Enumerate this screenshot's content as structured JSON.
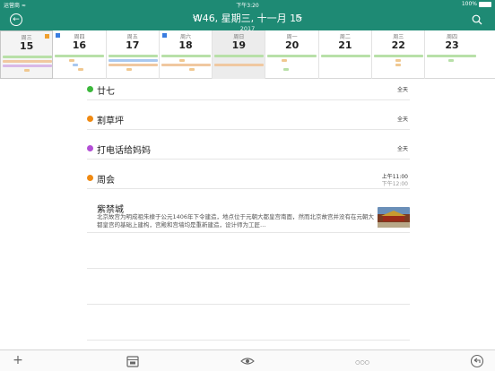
{
  "status_bar": {
    "carrier": "运营商 ≈",
    "time": "下午3:20",
    "battery": "100%"
  },
  "header": {
    "title": "W46, 星期三, 十一月 15",
    "subtitle": "2017",
    "colors": {
      "accent": "#1e8a74"
    }
  },
  "week": {
    "days": [
      {
        "name": "周三",
        "num": "15"
      },
      {
        "name": "周四",
        "num": "16"
      },
      {
        "name": "周五",
        "num": "17"
      },
      {
        "name": "周六",
        "num": "18"
      },
      {
        "name": "周日",
        "num": "19"
      },
      {
        "name": "周一",
        "num": "20"
      },
      {
        "name": "周二",
        "num": "21"
      },
      {
        "name": "周三",
        "num": "22"
      },
      {
        "name": "周四",
        "num": "23"
      }
    ]
  },
  "events": [
    {
      "title": "廿七",
      "time": "全天",
      "color": "#3cb83c"
    },
    {
      "title": "割草坪",
      "time": "全天",
      "color": "#f08a12"
    },
    {
      "title": "打电话给妈妈",
      "time": "全天",
      "color": "#b34fd6"
    },
    {
      "title": "周会",
      "start": "上午11:00",
      "end": "下午12:00",
      "color": "#f08a12"
    }
  ],
  "poi": {
    "title": "紫禁城",
    "description": "北京故宫为明成祖朱棣于公元1406年下令建造，地点位于元朝大都皇宫南面，然而北京故宫并没有在元朝大都皇宫的基础上建构，宫殿和宫墙均是重新建造，设计师为工匠…"
  },
  "toolbar": {
    "add": "+",
    "more": "○○○"
  }
}
